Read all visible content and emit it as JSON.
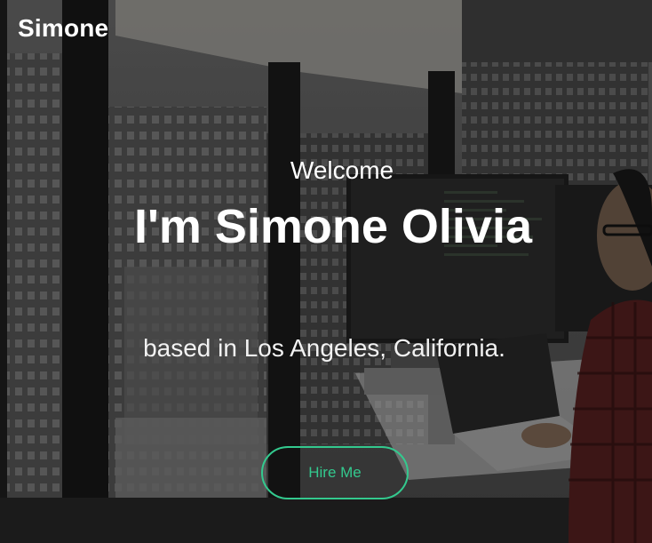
{
  "nav": {
    "brand": "Simone"
  },
  "hero": {
    "welcome": "Welcome",
    "name": "I'm Simone Olivia",
    "location": "based in Los Angeles, California.",
    "cta_label": "Hire Me"
  },
  "colors": {
    "accent": "#33c98e",
    "text": "#ffffff"
  }
}
